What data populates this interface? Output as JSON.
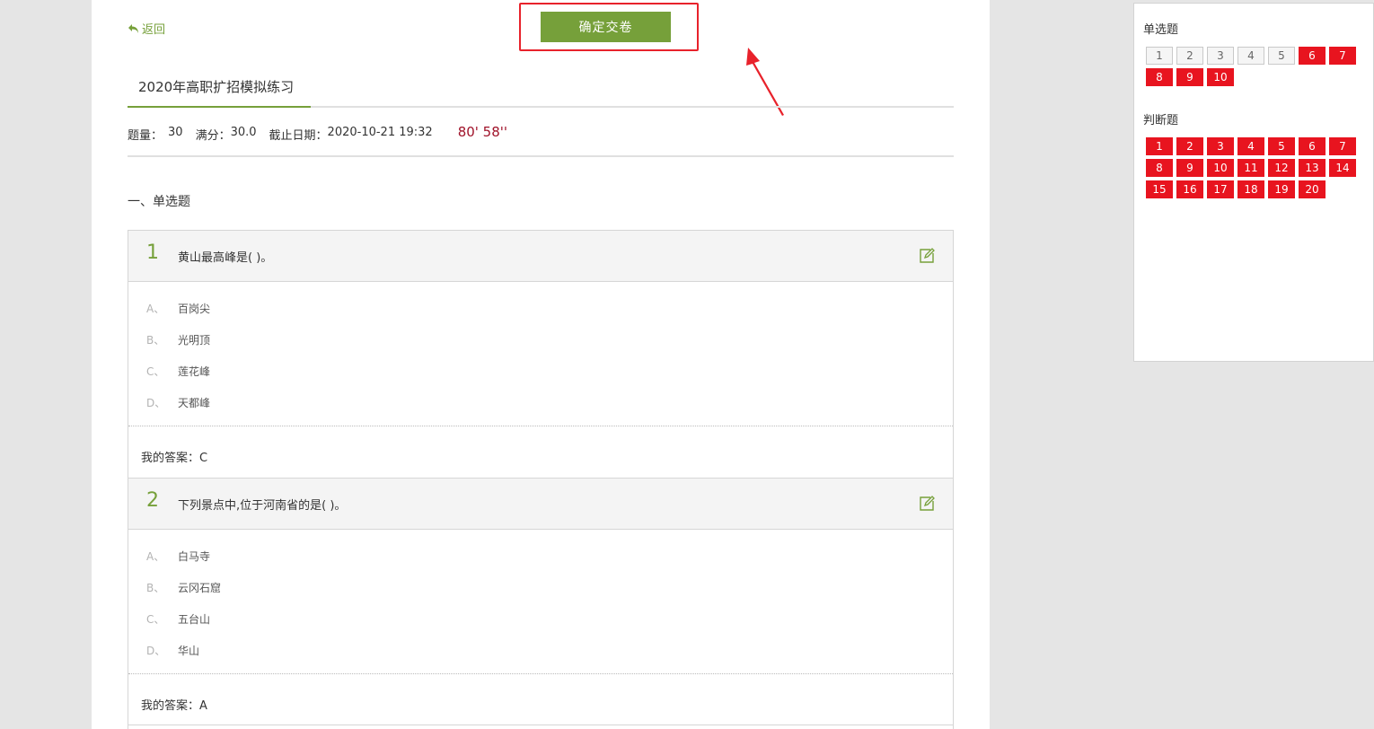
{
  "header": {
    "back_label": "返回",
    "submit_label": "确定交卷"
  },
  "exam": {
    "title": "2020年高职扩招模拟练习",
    "count_label": "题量：",
    "count_value": "30",
    "score_label": "满分：",
    "score_value": "30.0",
    "deadline_label": "截止日期：",
    "deadline_value": "2020-10-21 19:32",
    "timer": "80' 58''"
  },
  "section": {
    "title": "一、单选题"
  },
  "questions": [
    {
      "number": "1",
      "text": "黄山最高峰是( )。",
      "options": [
        {
          "letter": "A、",
          "text": "百岗尖"
        },
        {
          "letter": "B、",
          "text": "光明顶"
        },
        {
          "letter": "C、",
          "text": "莲花峰"
        },
        {
          "letter": "D、",
          "text": "天都峰"
        }
      ],
      "answer": "我的答案：C"
    },
    {
      "number": "2",
      "text": "下列景点中,位于河南省的是( )。",
      "options": [
        {
          "letter": "A、",
          "text": "白马寺"
        },
        {
          "letter": "B、",
          "text": "云冈石窟"
        },
        {
          "letter": "C、",
          "text": "五台山"
        },
        {
          "letter": "D、",
          "text": "华山"
        }
      ],
      "answer": "我的答案：A"
    }
  ],
  "sidebar": {
    "single_title": "单选题",
    "single_items": [
      {
        "label": "1",
        "answered": false
      },
      {
        "label": "2",
        "answered": false
      },
      {
        "label": "3",
        "answered": false
      },
      {
        "label": "4",
        "answered": false
      },
      {
        "label": "5",
        "answered": false
      },
      {
        "label": "6",
        "answered": true
      },
      {
        "label": "7",
        "answered": true
      },
      {
        "label": "8",
        "answered": true
      },
      {
        "label": "9",
        "answered": true
      },
      {
        "label": "10",
        "answered": true
      }
    ],
    "judge_title": "判断题",
    "judge_items": [
      {
        "label": "1",
        "answered": true
      },
      {
        "label": "2",
        "answered": true
      },
      {
        "label": "3",
        "answered": true
      },
      {
        "label": "4",
        "answered": true
      },
      {
        "label": "5",
        "answered": true
      },
      {
        "label": "6",
        "answered": true
      },
      {
        "label": "7",
        "answered": true
      },
      {
        "label": "8",
        "answered": true
      },
      {
        "label": "9",
        "answered": true
      },
      {
        "label": "10",
        "answered": true
      },
      {
        "label": "11",
        "answered": true
      },
      {
        "label": "12",
        "answered": true
      },
      {
        "label": "13",
        "answered": true
      },
      {
        "label": "14",
        "answered": true
      },
      {
        "label": "15",
        "answered": true
      },
      {
        "label": "16",
        "answered": true
      },
      {
        "label": "17",
        "answered": true
      },
      {
        "label": "18",
        "answered": true
      },
      {
        "label": "19",
        "answered": true
      },
      {
        "label": "20",
        "answered": true
      }
    ]
  },
  "colors": {
    "accent": "#76a03a",
    "answered": "#e8141f",
    "highlight_box": "#e8222b",
    "timer": "#a0132a"
  },
  "icons": {
    "back": "back-arrow-icon",
    "edit": "edit-icon",
    "annotation": "annotation-arrow-icon"
  }
}
